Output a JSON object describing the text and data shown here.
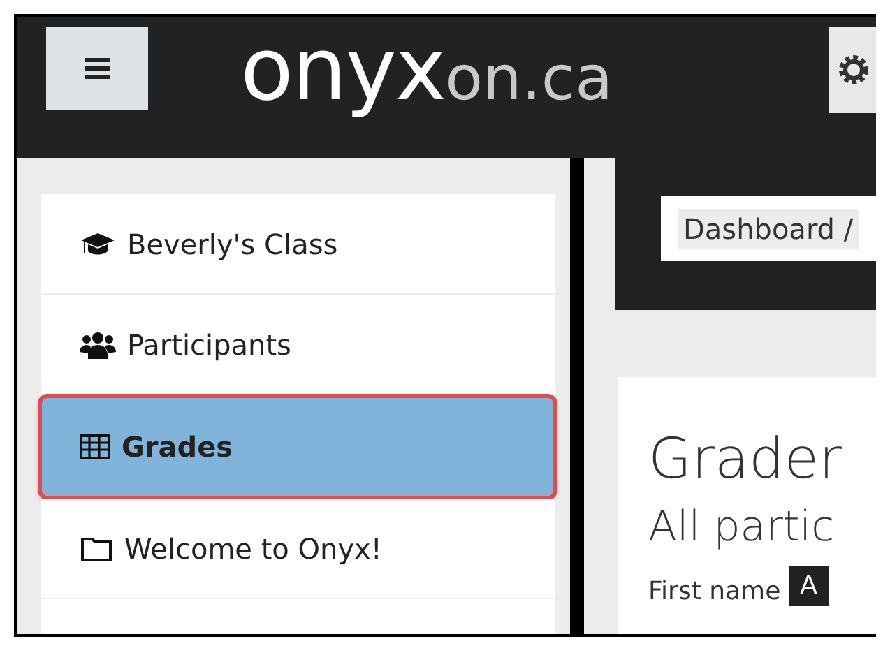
{
  "header": {
    "logo_main": "onyx",
    "logo_suffix": "on.ca"
  },
  "sidebar": {
    "items": [
      {
        "label": "Beverly's Class",
        "kind": "course",
        "selected": false
      },
      {
        "label": "Participants",
        "kind": "participants",
        "selected": false
      },
      {
        "label": "Grades",
        "kind": "grades",
        "selected": true
      },
      {
        "label": "Welcome to Onyx!",
        "kind": "section",
        "selected": false
      }
    ]
  },
  "breadcrumb": "Dashboard /",
  "page": {
    "title": "Grader",
    "subtitle": "All partic",
    "filter_label": "First name",
    "filter_button": "A"
  }
}
